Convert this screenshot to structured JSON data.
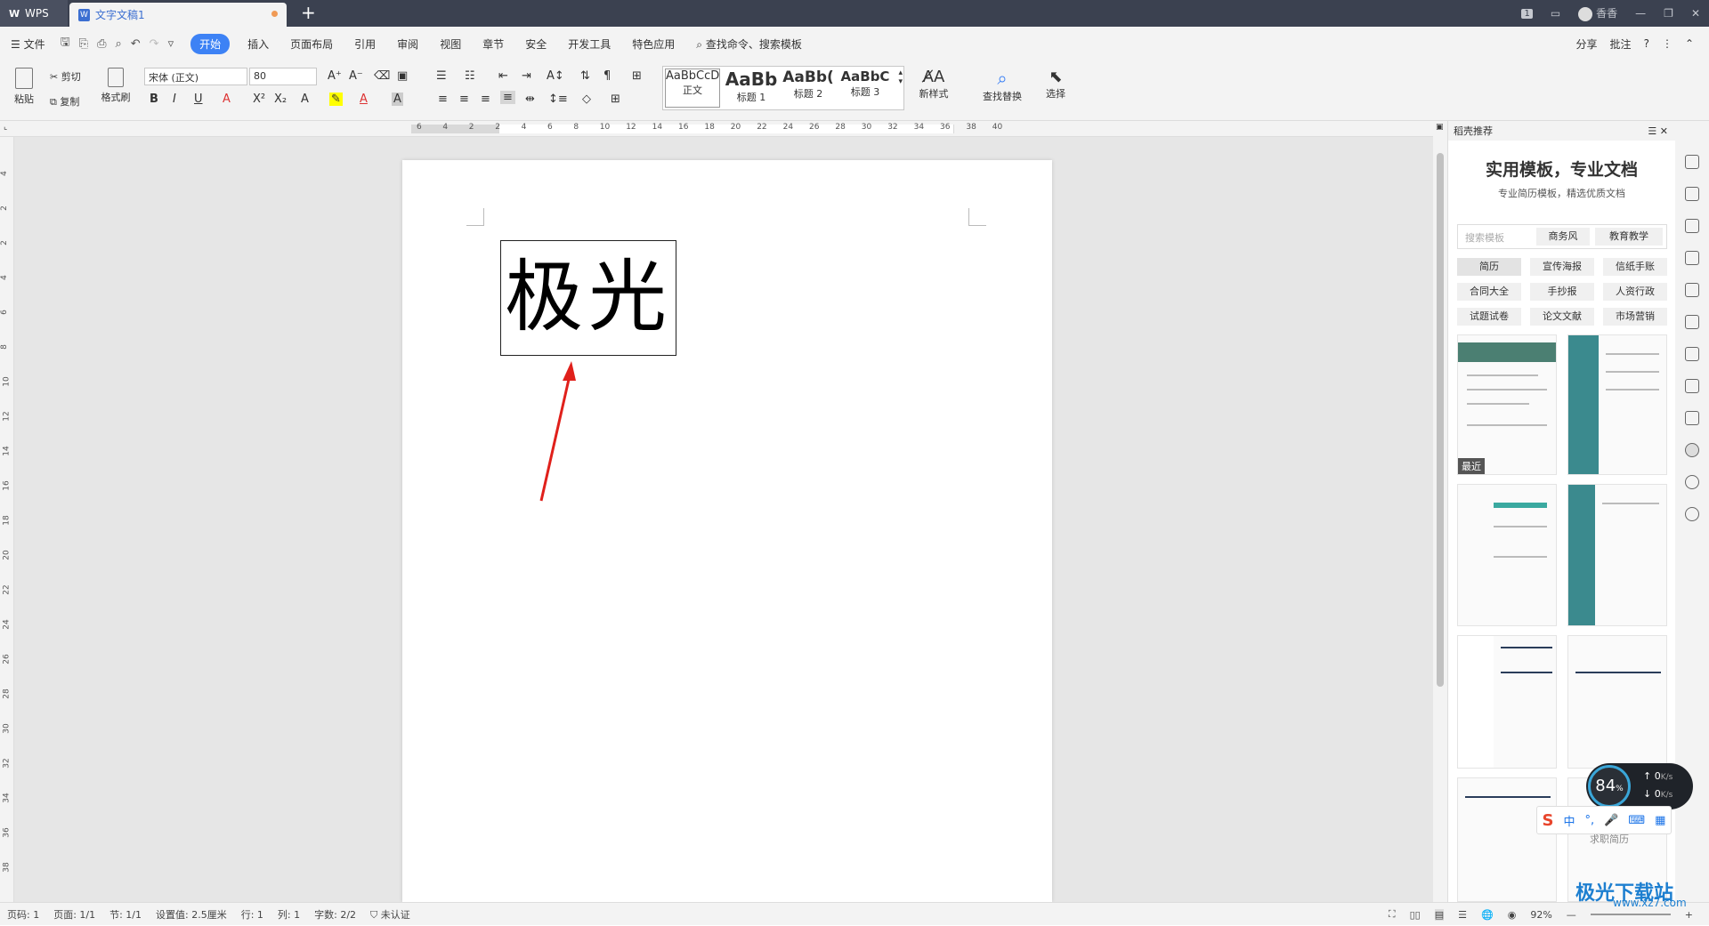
{
  "titlebar": {
    "app": "WPS",
    "doc_tab": "文字文稿1",
    "new_tab": "+",
    "badge": "1",
    "user": "香香"
  },
  "menubar": {
    "file": "文件",
    "items": [
      "开始",
      "插入",
      "页面布局",
      "引用",
      "审阅",
      "视图",
      "章节",
      "安全",
      "开发工具",
      "特色应用"
    ],
    "active": "开始",
    "search": "查找命令、搜索模板",
    "share": "分享",
    "comment": "批注",
    "help": "?"
  },
  "ribbon": {
    "paste": "粘贴",
    "cut": "剪切",
    "copy": "复制",
    "format_painter": "格式刷",
    "font_name": "宋体 (正文)",
    "font_size": "80",
    "bold": "B",
    "italic": "I",
    "underline": "U",
    "styles": [
      {
        "sample": "AaBbCcD",
        "label": "正文"
      },
      {
        "sample": "AaBb",
        "label": "标题 1"
      },
      {
        "sample": "AaBb(",
        "label": "标题 2"
      },
      {
        "sample": "AaBbC",
        "label": "标题 3"
      }
    ],
    "new_style": "新样式",
    "find_replace": "查找替换",
    "select": "选择"
  },
  "ruler_h": [
    "6",
    "4",
    "2",
    "2",
    "4",
    "6",
    "8",
    "10",
    "12",
    "14",
    "16",
    "18",
    "20",
    "22",
    "24",
    "26",
    "28",
    "30",
    "32",
    "34",
    "36",
    "38",
    "40"
  ],
  "ruler_v": [
    "4",
    "2",
    "2",
    "4",
    "6",
    "8",
    "10",
    "12",
    "14",
    "16",
    "18",
    "20",
    "22",
    "24",
    "26",
    "28",
    "30",
    "32",
    "34",
    "36",
    "38"
  ],
  "document": {
    "text": "极光"
  },
  "panel": {
    "header": "稻壳推荐",
    "title": "实用模板，专业文档",
    "subtitle": "专业简历模板，精选优质文档",
    "search_placeholder": "搜索模板",
    "chips": [
      "商务风",
      "教育教学",
      "简历",
      "宣传海报",
      "信纸手账",
      "合同大全",
      "手抄报",
      "人资行政",
      "试题试卷",
      "论文文献",
      "市场营销"
    ],
    "recent": "最近",
    "resume_label": "求职简历"
  },
  "network": {
    "percent": "84",
    "unit": "%",
    "up": "0",
    "down": "0",
    "rate_unit": "K/s"
  },
  "ime": {
    "logo": "S",
    "lang": "中"
  },
  "statusbar": {
    "page_num": "页码: 1",
    "pages": "页面: 1/1",
    "section": "节: 1/1",
    "setting": "设置值: 2.5厘米",
    "row": "行: 1",
    "col": "列: 1",
    "words": "字数: 2/2",
    "cert": "未认证",
    "zoom": "92%"
  },
  "watermark": {
    "name": "极光下载站",
    "url": "www.xz7.com"
  },
  "colors": {
    "accent": "#3d82f5",
    "titlebar": "#3b4150",
    "arrow": "#e0201b"
  }
}
